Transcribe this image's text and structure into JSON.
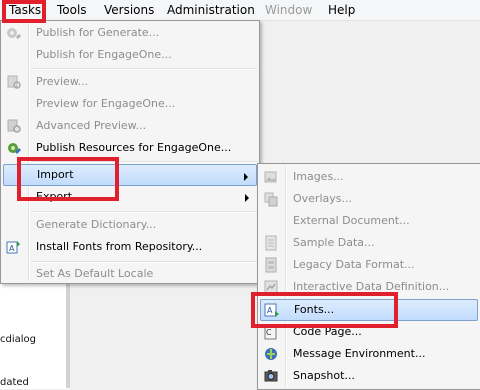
{
  "menubar": {
    "items": [
      "Tasks",
      "Tools",
      "Versions",
      "Administration",
      "Window",
      "Help"
    ]
  },
  "tasks_menu": {
    "items": [
      {
        "label": "Publish for Generate...",
        "enabled": false,
        "icon": "publish-icon"
      },
      {
        "label": "Publish for EngageOne...",
        "enabled": false,
        "icon": ""
      },
      {
        "label": "Preview...",
        "enabled": false,
        "icon": "preview-icon"
      },
      {
        "label": "Preview for EngageOne...",
        "enabled": false,
        "icon": ""
      },
      {
        "label": "Advanced Preview...",
        "enabled": false,
        "icon": "advanced-preview-icon"
      },
      {
        "label": "Publish Resources for EngageOne...",
        "enabled": true,
        "icon": "publish-resources-icon"
      },
      {
        "label": "Import",
        "enabled": true,
        "icon": "",
        "submenu": true,
        "highlighted": true
      },
      {
        "label": "Export",
        "enabled": true,
        "icon": "",
        "submenu": true
      },
      {
        "label": "Generate Dictionary...",
        "enabled": false,
        "icon": ""
      },
      {
        "label": "Install Fonts from Repository...",
        "enabled": true,
        "icon": "install-fonts-icon"
      },
      {
        "label": "Set As Default Locale",
        "enabled": false,
        "icon": ""
      }
    ]
  },
  "import_submenu": {
    "items": [
      {
        "label": "Images...",
        "enabled": false,
        "icon": "images-icon"
      },
      {
        "label": "Overlays...",
        "enabled": false,
        "icon": "overlays-icon"
      },
      {
        "label": "External Document...",
        "enabled": false,
        "icon": "external-document-icon"
      },
      {
        "label": "Sample Data...",
        "enabled": false,
        "icon": "sample-data-icon"
      },
      {
        "label": "Legacy Data Format...",
        "enabled": false,
        "icon": "legacy-data-icon"
      },
      {
        "label": "Interactive Data Definition...",
        "enabled": false,
        "icon": "interactive-data-icon"
      },
      {
        "label": "Fonts...",
        "enabled": true,
        "icon": "fonts-icon",
        "highlighted": true
      },
      {
        "label": "Code Page...",
        "enabled": true,
        "icon": "code-page-icon"
      },
      {
        "label": "Message Environment...",
        "enabled": true,
        "icon": "message-environment-icon"
      },
      {
        "label": "Snapshot...",
        "enabled": true,
        "icon": "snapshot-icon"
      }
    ]
  },
  "background": {
    "text_1": "cdialog",
    "text_2": "dated"
  },
  "colors": {
    "annotation": "#e0202c",
    "highlight_border": "#7da2ce"
  }
}
